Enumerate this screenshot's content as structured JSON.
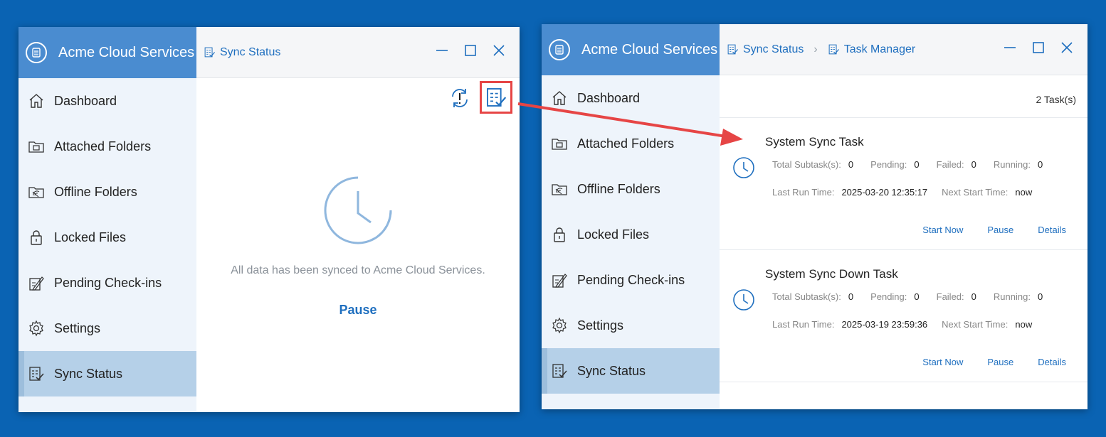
{
  "app": {
    "brand": "Acme Cloud Services"
  },
  "nav": [
    {
      "label": "Dashboard",
      "icon": "home-icon"
    },
    {
      "label": "Attached Folders",
      "icon": "attached-folder-icon"
    },
    {
      "label": "Offline Folders",
      "icon": "offline-folder-icon"
    },
    {
      "label": "Locked Files",
      "icon": "lock-icon"
    },
    {
      "label": "Pending Check-ins",
      "icon": "pending-checkin-icon"
    },
    {
      "label": "Settings",
      "icon": "gear-icon"
    },
    {
      "label": "Sync Status",
      "icon": "sync-status-icon"
    }
  ],
  "window1": {
    "breadcrumb": "Sync Status",
    "message": "All data has been synced to Acme Cloud Services.",
    "pause_label": "Pause"
  },
  "window2": {
    "breadcrumb": [
      "Sync Status",
      "Task Manager"
    ],
    "task_count": "2 Task(s)",
    "labels": {
      "total": "Total Subtask(s):",
      "pending": "Pending:",
      "failed": "Failed:",
      "running": "Running:",
      "last_run": "Last Run Time:",
      "next_start": "Next Start Time:"
    },
    "tasks": [
      {
        "name": "System Sync Task",
        "total": "0",
        "pending": "0",
        "failed": "0",
        "running": "0",
        "last_run": "2025-03-20 12:35:17",
        "next_start": "now",
        "actions": [
          "Start Now",
          "Pause",
          "Details"
        ]
      },
      {
        "name": "System Sync Down Task",
        "total": "0",
        "pending": "0",
        "failed": "0",
        "running": "0",
        "last_run": "2025-03-19 23:59:36",
        "next_start": "now",
        "actions": [
          "Start Now",
          "Pause",
          "Details"
        ]
      }
    ]
  },
  "colors": {
    "desktop": "#0a63b3",
    "brand_bar": "#4a8cd0",
    "accent": "#1f6fbf",
    "highlight": "#e64545"
  }
}
